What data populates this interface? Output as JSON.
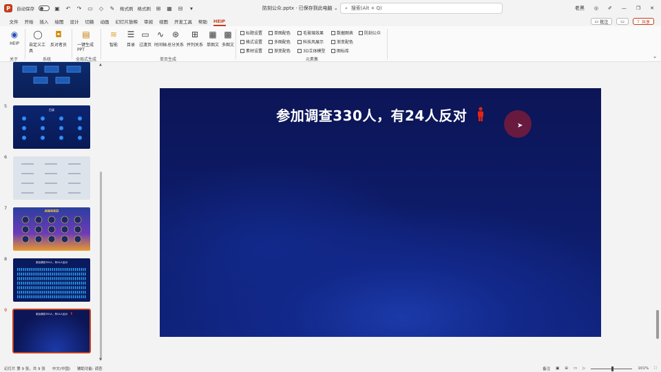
{
  "titlebar": {
    "app_icon": "P",
    "autosave": "自动保存",
    "format_painter": "格式刷",
    "format_painter_2": "格式刷",
    "file_name": "防刻公众.pptx · 已保存到此电脑",
    "search_placeholder": "搜索(Alt + Q)",
    "user": "老黑",
    "icons": [
      "save-icon",
      "undo-icon",
      "redo-icon",
      "layout-icon",
      "shape-icon",
      "table-icon",
      "image-icon",
      "dropdown-icon"
    ]
  },
  "menu": {
    "items": [
      "文件",
      "开始",
      "插入",
      "绘图",
      "设计",
      "切换",
      "动画",
      "幻灯片放映",
      "审阅",
      "视图",
      "开发工具",
      "帮助",
      "HEIP"
    ],
    "active_index": 12,
    "comment_label": "批注",
    "share_label": "共享"
  },
  "ribbon": {
    "buttons": [
      {
        "label": "HEIP",
        "icon": "heip-logo-icon"
      },
      {
        "label": "自定义工具",
        "icon": "speech-icon"
      },
      {
        "label": "反对者员",
        "icon": "cup-icon"
      },
      {
        "label": "一键生成PPT",
        "icon": "ppt-icon"
      },
      {
        "label": "智能",
        "icon": "layers-icon"
      },
      {
        "label": "目录",
        "icon": "list-icon"
      },
      {
        "label": "过渡页",
        "icon": "page-icon"
      },
      {
        "label": "时间轴",
        "icon": "timeline-icon"
      },
      {
        "label": "总分关系",
        "icon": "hub-icon"
      },
      {
        "label": "并列关系",
        "icon": "grid-icon"
      },
      {
        "label": "单图文",
        "icon": "image-text-icon"
      },
      {
        "label": "多图文",
        "icon": "multi-image-icon"
      }
    ],
    "group_labels": [
      "关于",
      "系统",
      "全局式生成",
      "单页生成",
      "元素集"
    ],
    "checkboxes": [
      "标题设置",
      "单图配色",
      "毛玻璃效果",
      "数据图表",
      "防刻公众",
      "格式设置",
      "多图配色",
      "科技风展示",
      "渐变配色",
      "素材设置",
      "渐变配色",
      "3D立体模型",
      "图标库"
    ]
  },
  "thumbnails": {
    "numbers": [
      "5",
      "6",
      "7",
      "8",
      "9"
    ],
    "slide5_title": "目录",
    "slide7_title": "AWARD",
    "slide8_title": "参加调查330人，有24人反对",
    "slide9_title": "参加调查330人，有24人反对"
  },
  "slide": {
    "title": "参加调查330人，有24人反对",
    "accent_color": "#e02418"
  },
  "status": {
    "slide_info": "幻灯片 第 9 张，共 9 张",
    "language": "中文(中国)",
    "accessibility": "辅助功能: 调查",
    "notes": "备注",
    "zoom": "101%"
  }
}
